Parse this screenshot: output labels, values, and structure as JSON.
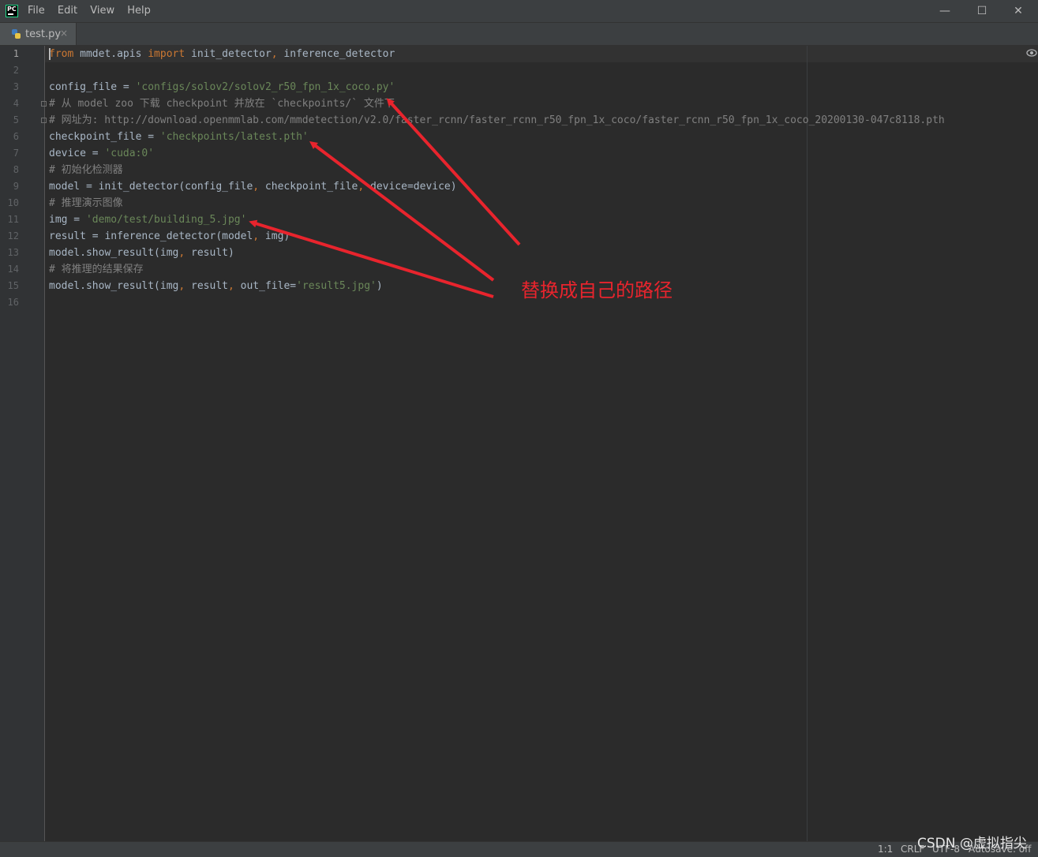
{
  "menu": {
    "file": "File",
    "edit": "Edit",
    "view": "View",
    "help": "Help"
  },
  "logo_text": "PC",
  "window_controls": {
    "minimize": "—",
    "maximize": "☐",
    "close": "✕"
  },
  "tab": {
    "filename": "test.py",
    "close": "×"
  },
  "line_numbers": [
    "1",
    "2",
    "3",
    "4",
    "5",
    "6",
    "7",
    "8",
    "9",
    "10",
    "11",
    "12",
    "13",
    "14",
    "15",
    "16"
  ],
  "code": {
    "l1": {
      "from": "from",
      "mod": " mmdet.apis ",
      "imp": "import",
      "fn1": " init_detector",
      "comma": ",",
      "fn2": " inference_detector"
    },
    "l3": {
      "name": "config_file = ",
      "val": "'configs/solov2/solov2_r50_fpn_1x_coco.py'"
    },
    "l4": "# 从 model zoo 下载 checkpoint 并放在 `checkpoints/` 文件下",
    "l5": "# 网址为: http://download.openmmlab.com/mmdetection/v2.0/faster_rcnn/faster_rcnn_r50_fpn_1x_coco/faster_rcnn_r50_fpn_1x_coco_20200130-047c8118.pth",
    "l6": {
      "name": "checkpoint_file = ",
      "val": "'checkpoints/latest.pth'"
    },
    "l7": {
      "name": "device = ",
      "val": "'cuda:0'"
    },
    "l8": "# 初始化检测器",
    "l9": {
      "a": "model = init_detector(config_file",
      "c1": ",",
      "b": " checkpoint_file",
      "c2": ",",
      "d": " device=device)"
    },
    "l10": "# 推理演示图像",
    "l11": {
      "name": "img = ",
      "val": "'demo/test/building_5.jpg'"
    },
    "l12": {
      "a": "result = inference_detector(model",
      "c1": ",",
      "b": " img)"
    },
    "l13": {
      "a": "model.show_result(img",
      "c1": ",",
      "b": " result)"
    },
    "l14": "# 将推理的结果保存",
    "l15": {
      "a": "model.show_result(img",
      "c1": ",",
      "b": " result",
      "c2": ",",
      "d": " out_file=",
      "val": "'result5.jpg'",
      "e": ")"
    }
  },
  "annotation": "替换成自己的路径",
  "watermark": "CSDN @虚拟指尖",
  "status": {
    "position": "1:1",
    "line_sep": "CRLF",
    "encoding": "UTF-8",
    "autosave": "Autosave: off"
  },
  "colors": {
    "keyword": "#cc7832",
    "string": "#6a8759",
    "comment": "#808080",
    "annotation": "#e8242d"
  }
}
